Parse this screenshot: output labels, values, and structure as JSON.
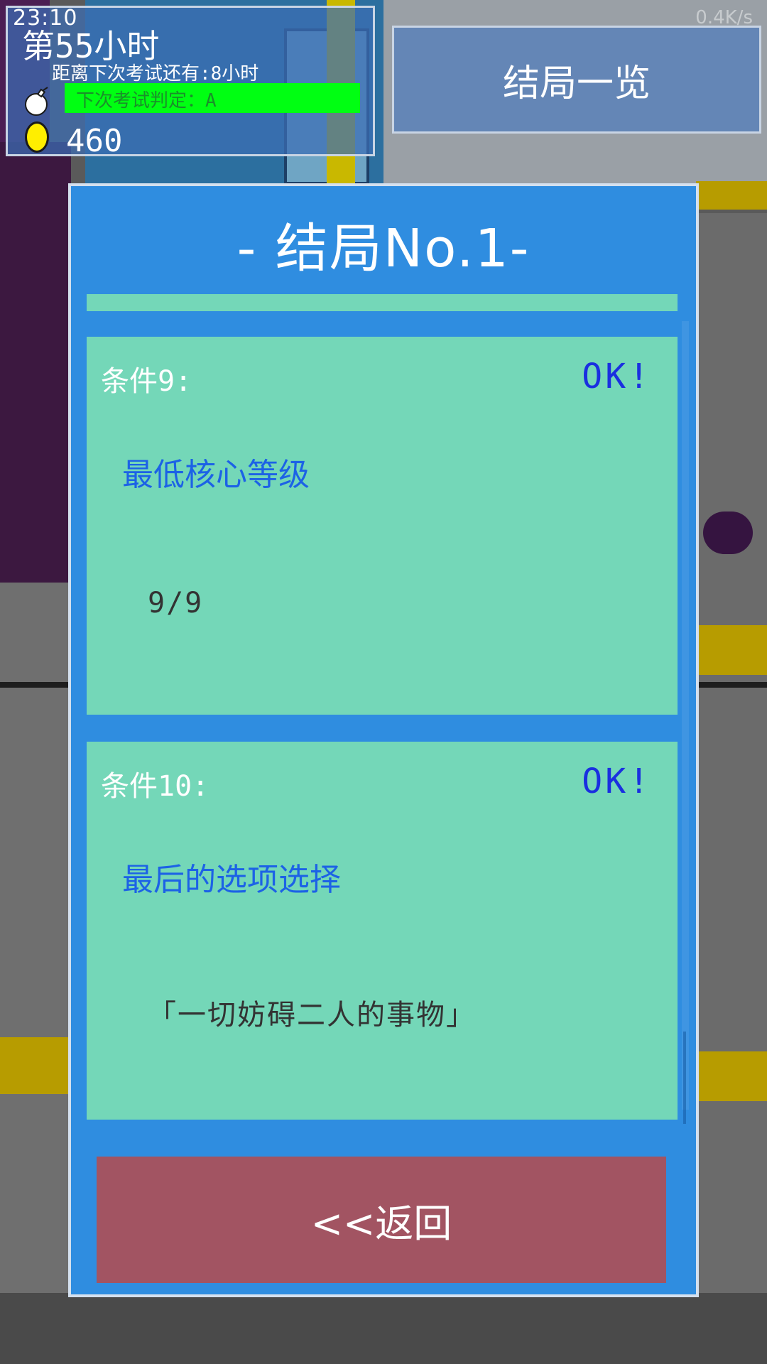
{
  "status_bar": {
    "time": "23:10",
    "network_speed": "0.4K/s"
  },
  "hud": {
    "hours_label": "第55小时",
    "countdown_label": "距离下次考试还有:8小时",
    "judge_label": "下次考试判定：A",
    "coins": "460"
  },
  "endings_button_label": "结局一览",
  "dialog": {
    "title": "- 结局No.1-",
    "conditions": [
      {
        "label": "条件9:",
        "status": "OK!",
        "name": "最低核心等级",
        "value": "9/9"
      },
      {
        "label": "条件10:",
        "status": "OK!",
        "name": "最后的选项选择",
        "value": "「一切妨碍二人的事物」"
      }
    ],
    "back_label": "<<返回"
  },
  "colors": {
    "dialog_bg": "#2f8de0",
    "card_bg": "#74d7b8",
    "ok_color": "#1a2fe0",
    "name_color": "#1c62e6",
    "back_button_bg": "#a25462",
    "judge_bar": "#00ff12"
  },
  "icons": {
    "bomb": "bomb-icon",
    "coin": "coin-icon"
  }
}
